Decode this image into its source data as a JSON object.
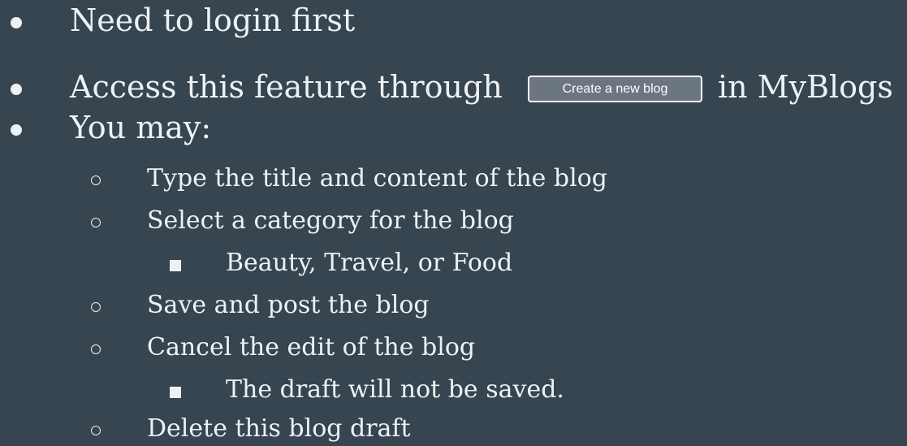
{
  "bullets": {
    "login": "Need to login first",
    "access_prefix": "Access this feature through",
    "access_suffix": "in MyBlogs",
    "you_may": "You may:"
  },
  "create_button": {
    "label": "Create a new blog"
  },
  "sub_bullets": {
    "type_title": "Type the title and content of the blog",
    "select_category": "Select a category for the blog",
    "categories": "Beauty, Travel, or Food",
    "save_post": "Save and post the blog",
    "cancel_edit": "Cancel the edit of the blog",
    "draft_note": "The draft will not be saved.",
    "delete_draft": "Delete this blog draft"
  },
  "colors": {
    "background": "#36454f",
    "text": "#eef1f4",
    "button_bg": "#6b7680"
  }
}
